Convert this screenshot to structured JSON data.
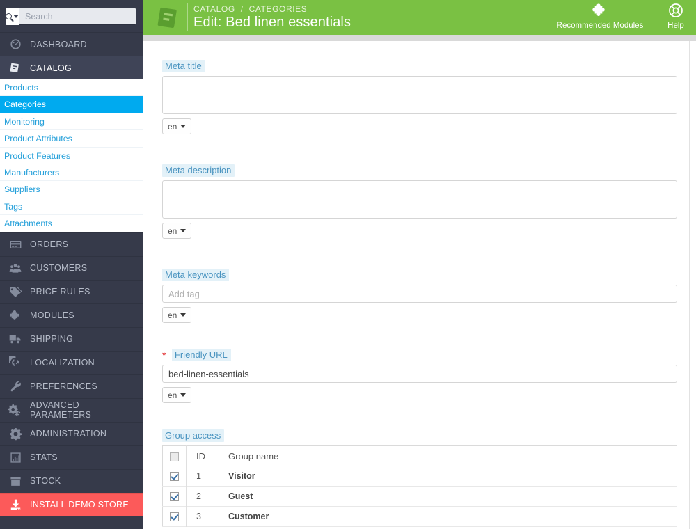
{
  "sidebar": {
    "search": {
      "placeholder": "Search",
      "value": "",
      "icon": "search-icon",
      "caret_icon": "caret-down-icon"
    },
    "items": [
      {
        "label": "DASHBOARD",
        "icon": "dashboard-gauge-icon",
        "state": "normal"
      },
      {
        "label": "CATALOG",
        "icon": "catalog-book-icon",
        "state": "active"
      },
      {
        "label": "ORDERS",
        "icon": "orders-card-icon",
        "state": "normal"
      },
      {
        "label": "CUSTOMERS",
        "icon": "customers-people-icon",
        "state": "normal"
      },
      {
        "label": "PRICE RULES",
        "icon": "price-tag-icon",
        "state": "normal"
      },
      {
        "label": "MODULES",
        "icon": "puzzle-piece-icon",
        "state": "normal"
      },
      {
        "label": "SHIPPING",
        "icon": "truck-icon",
        "state": "normal"
      },
      {
        "label": "LOCALIZATION",
        "icon": "globe-icon",
        "state": "normal"
      },
      {
        "label": "PREFERENCES",
        "icon": "wrench-icon",
        "state": "normal"
      },
      {
        "label": "ADVANCED PARAMETERS",
        "icon": "gears-icon",
        "state": "normal"
      },
      {
        "label": "ADMINISTRATION",
        "icon": "gear-icon",
        "state": "normal"
      },
      {
        "label": "STATS",
        "icon": "bar-chart-icon",
        "state": "normal"
      },
      {
        "label": "STOCK",
        "icon": "box-icon",
        "state": "normal"
      },
      {
        "label": "INSTALL DEMO STORE",
        "icon": "download-icon",
        "state": "danger"
      }
    ],
    "catalog_submenu": [
      {
        "label": "Products",
        "state": "normal"
      },
      {
        "label": "Categories",
        "state": "active"
      },
      {
        "label": "Monitoring",
        "state": "normal"
      },
      {
        "label": "Product Attributes",
        "state": "normal"
      },
      {
        "label": "Product Features",
        "state": "normal"
      },
      {
        "label": "Manufacturers",
        "state": "normal"
      },
      {
        "label": "Suppliers",
        "state": "normal"
      },
      {
        "label": "Tags",
        "state": "normal"
      },
      {
        "label": "Attachments",
        "state": "normal"
      }
    ]
  },
  "header": {
    "icon": "catalog-book-icon",
    "breadcrumb": {
      "parent": "CATALOG",
      "separator": "/",
      "current": "CATEGORIES"
    },
    "title": "Edit: Bed linen essentials",
    "actions": [
      {
        "label": "Recommended Modules",
        "icon": "puzzle-piece-icon"
      },
      {
        "label": "Help",
        "icon": "lifebuoy-icon"
      }
    ],
    "accent_color": "#7ac143"
  },
  "form": {
    "meta_title": {
      "label": "Meta title",
      "value": "",
      "placeholder": "",
      "lang": "en",
      "required": false
    },
    "meta_description": {
      "label": "Meta description",
      "value": "",
      "placeholder": "",
      "lang": "en",
      "required": false
    },
    "meta_keywords": {
      "label": "Meta keywords",
      "value": "",
      "placeholder": "Add tag",
      "lang": "en",
      "required": false
    },
    "friendly_url": {
      "label": "Friendly URL",
      "value": "bed-linen-essentials",
      "placeholder": "",
      "lang": "en",
      "required": true,
      "required_marker": "*"
    },
    "group_access": {
      "label": "Group access",
      "columns": [
        "",
        "ID",
        "Group name"
      ],
      "header_checkbox_checked": false,
      "rows": [
        {
          "checked": true,
          "id": "1",
          "name": "Visitor"
        },
        {
          "checked": true,
          "id": "2",
          "name": "Guest"
        },
        {
          "checked": true,
          "id": "3",
          "name": "Customer"
        }
      ]
    }
  },
  "colors": {
    "sidebar_bg": "#363a4a",
    "sidebar_active": "#3f4457",
    "submenu_active": "#00aaef",
    "submenu_link": "#25a0da",
    "header_green": "#7ac143",
    "danger_red": "#fc5a5a",
    "label_bg": "#e3f1f8",
    "label_text": "#4a94c0"
  }
}
